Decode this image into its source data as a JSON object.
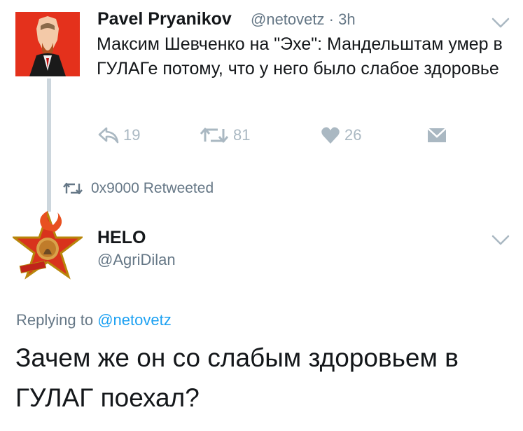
{
  "tweet": {
    "author_name": "Pavel Pryanikov",
    "author_handle": "@netovetz",
    "separator": "·",
    "time": "3h",
    "text": "Максим Шевченко на \"Эхе\": Мандельштам умер в ГУЛАГе потому, что у него было слабое здоровье",
    "reply_count": "19",
    "retweet_count": "81",
    "like_count": "26"
  },
  "retweet_banner": {
    "text": "0x9000 Retweeted"
  },
  "reply": {
    "author_name": "HELO",
    "author_handle": "@AgriDilan",
    "replying_prefix": "Replying to",
    "replying_to": "@netovetz",
    "text": "Зачем же он со слабым здоровьем в ГУЛАГ поехал?"
  },
  "colors": {
    "text_primary": "#14171a",
    "text_secondary": "#657786",
    "icon_gray": "#aab8c2",
    "link_blue": "#1da1f2",
    "avatar_red": "#e4311c"
  },
  "icons": [
    "reply-icon",
    "retweet-icon",
    "heart-icon",
    "envelope-icon",
    "chevron-down-icon",
    "retweet-small-icon"
  ]
}
